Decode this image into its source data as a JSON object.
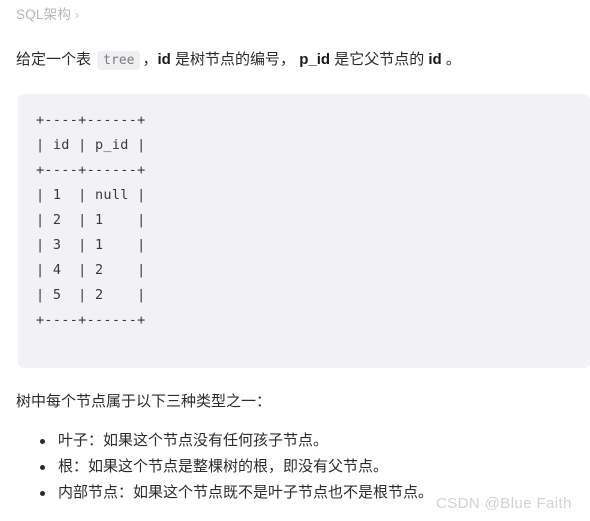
{
  "breadcrumb": {
    "label": "SQL架构",
    "separator": "›"
  },
  "intro": {
    "prefix": "给定一个表 ",
    "table_name": "tree",
    "mid1": "，",
    "bold1": "id",
    "mid2": " 是树节点的编号，  ",
    "bold2": "p_id",
    "mid3": " 是它父节点的 ",
    "bold3": "id",
    "suffix": " 。"
  },
  "code_block": {
    "language": "text",
    "content": "+----+------+\n| id | p_id |\n+----+------+\n| 1  | null |\n| 2  | 1    |\n| 3  | 1    |\n| 4  | 2    |\n| 5  | 2    |\n+----+------+"
  },
  "table_data": {
    "type": "table",
    "columns": [
      "id",
      "p_id"
    ],
    "rows": [
      [
        "1",
        "null"
      ],
      [
        "2",
        "1"
      ],
      [
        "3",
        "1"
      ],
      [
        "4",
        "2"
      ],
      [
        "5",
        "2"
      ]
    ]
  },
  "section": {
    "lead": "树中每个节点属于以下三种类型之一："
  },
  "bullets": [
    {
      "text": "叶子：如果这个节点没有任何孩子节点。"
    },
    {
      "text": "根：如果这个节点是整棵树的根，即没有父节点。"
    },
    {
      "text": "内部节点：如果这个节点既不是叶子节点也不是根节点。"
    }
  ],
  "watermark": {
    "text": "CSDN @Blue Faith"
  },
  "colors": {
    "page_background": "#ffffff",
    "text": "#2b2b2b",
    "breadcrumb": "#b5b5bd",
    "code_background": "#f2f2f5",
    "code_text": "#3a3a3a",
    "chip_background": "#f0f0f2",
    "chip_text": "#7a7a82",
    "watermark": "#d2d2d6"
  }
}
